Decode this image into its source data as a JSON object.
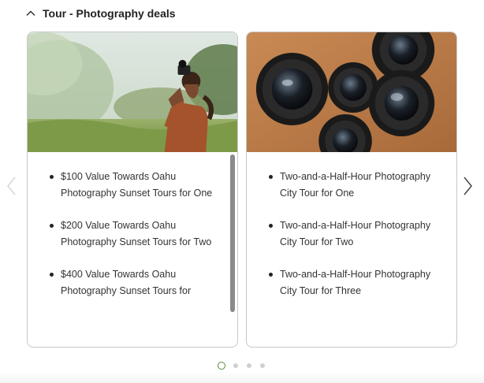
{
  "section": {
    "title": "Tour - Photography deals",
    "toggle_icon": "chevron-up-icon"
  },
  "carousel": {
    "prev_icon": "chevron-left-icon",
    "next_icon": "chevron-right-icon",
    "dots_total": 4,
    "active_dot": 1,
    "cards": [
      {
        "image": "woman-photographer-photo",
        "items": [
          "$100 Value Towards Oahu Photography Sunset Tours for One",
          "$200 Value Towards Oahu Photography Sunset Tours for Two",
          "$400 Value Towards Oahu Photography Sunset Tours for"
        ]
      },
      {
        "image": "camera-lenses-photo",
        "items": [
          "Two-and-a-Half-Hour Photography City Tour for One",
          "Two-and-a-Half-Hour Photography City Tour for Two",
          "Two-and-a-Half-Hour Photography City Tour for Three"
        ]
      }
    ]
  },
  "colors": {
    "active_dot": "#5a8a3a",
    "card_border": "#c8c8c8"
  }
}
